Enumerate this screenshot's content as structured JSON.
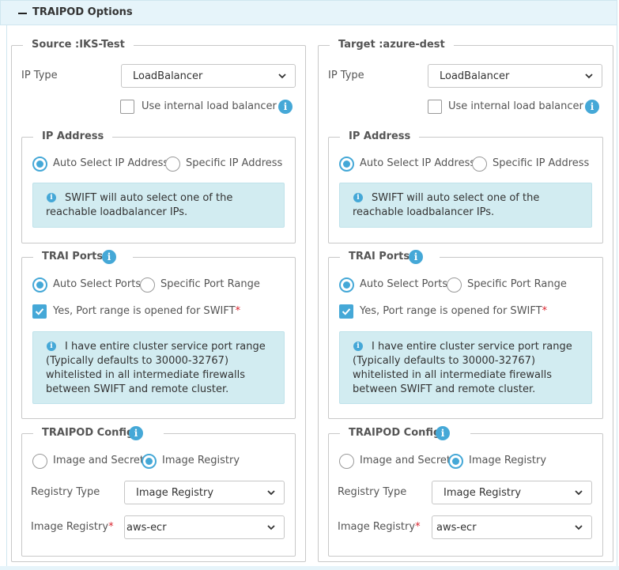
{
  "header": {
    "title": "TRAIPOD Options"
  },
  "panels": [
    {
      "legend": "Source :IKS-Test",
      "ip_type_label": "IP Type",
      "ip_type_value": "LoadBalancer",
      "internal_lb_label": "Use internal load balancer",
      "ip_address": {
        "legend": "IP Address",
        "auto_label": "Auto Select IP Address",
        "specific_label": "Specific IP Address",
        "selected": "auto",
        "info_text": "SWIFT will auto select one of the reachable loadbalancer IPs."
      },
      "trai_ports": {
        "legend": "TRAI Ports",
        "auto_label": "Auto Select Ports",
        "specific_label": "Specific Port Range",
        "selected": "auto",
        "opened_label": "Yes, Port range is opened for SWIFT",
        "opened_checked": true,
        "required_mark": "*",
        "info_text": "I have entire cluster service port range (Typically defaults to 30000-32767) whitelisted in all intermediate firewalls between SWIFT and remote cluster."
      },
      "traipod_config": {
        "legend": "TRAIPOD Config",
        "image_secret_label": "Image and Secret",
        "image_registry_option_label": "Image Registry",
        "selected": "registry",
        "registry_type_label": "Registry Type",
        "registry_type_value": "Image Registry",
        "image_registry_label": "Image Registry",
        "required_mark": "*",
        "image_registry_value": "aws-ecr"
      }
    },
    {
      "legend": "Target :azure-dest",
      "ip_type_label": "IP Type",
      "ip_type_value": "LoadBalancer",
      "internal_lb_label": "Use internal load balancer",
      "ip_address": {
        "legend": "IP Address",
        "auto_label": "Auto Select IP Address",
        "specific_label": "Specific IP Address",
        "selected": "auto",
        "info_text": "SWIFT will auto select one of the reachable loadbalancer IPs."
      },
      "trai_ports": {
        "legend": "TRAI Ports",
        "auto_label": "Auto Select Ports",
        "specific_label": "Specific Port Range",
        "selected": "auto",
        "opened_label": "Yes, Port range is opened for SWIFT",
        "opened_checked": true,
        "required_mark": "*",
        "info_text": "I have entire cluster service port range (Typically defaults to 30000-32767) whitelisted in all intermediate firewalls between SWIFT and remote cluster."
      },
      "traipod_config": {
        "legend": "TRAIPOD Config",
        "image_secret_label": "Image and Secret",
        "image_registry_option_label": "Image Registry",
        "selected": "registry",
        "registry_type_label": "Registry Type",
        "registry_type_value": "Image Registry",
        "image_registry_label": "Image Registry",
        "required_mark": "*",
        "image_registry_value": "aws-ecr"
      }
    }
  ],
  "colors": {
    "accent": "#45a8d7",
    "info_bg": "#d2ecf1",
    "header_bg": "#e6f4fa",
    "required": "#d9232d"
  }
}
